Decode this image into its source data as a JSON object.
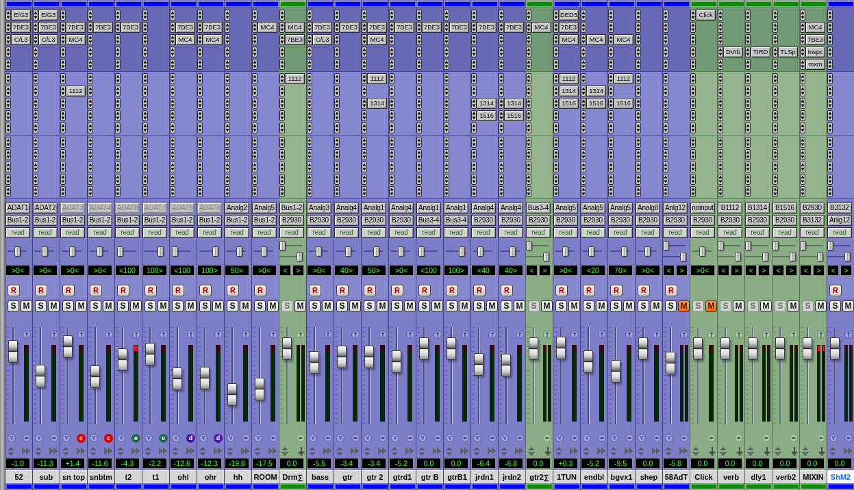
{
  "strips": [
    {
      "color": "#0000ff",
      "kind": "audio",
      "inserts": [
        {
          "assigned": true,
          "label": "E/G3"
        },
        {
          "assigned": true,
          "label": "7BE3"
        },
        {
          "assigned": true,
          "label": "C/L3"
        },
        {
          "assigned": false
        },
        {
          "assigned": false
        }
      ],
      "sends": [
        {
          "assigned": false
        },
        {
          "assigned": false
        },
        {
          "assigned": false
        },
        {
          "assigned": false
        },
        {
          "assigned": false
        }
      ],
      "input": "ADAT1",
      "input_inactive": false,
      "output": "Bus1-2",
      "automation": "read",
      "pans": [
        {
          "level": 0.5,
          "reading": ">0<"
        }
      ],
      "record": "R",
      "solo": "S",
      "solo_disabled": false,
      "mute": "M",
      "muted": false,
      "fader": {
        "level": 0.83,
        "reading": "-1.0"
      },
      "meters": [
        {
          "clipped": false
        }
      ],
      "voice": "v",
      "name": "52",
      "selected": false
    },
    {
      "color": "#0000ff",
      "kind": "audio",
      "inserts": [
        {
          "assigned": true,
          "label": "E/G3"
        },
        {
          "assigned": true,
          "label": "7BE3"
        },
        {
          "assigned": true,
          "label": "C/L3"
        },
        {
          "assigned": false
        },
        {
          "assigned": false
        }
      ],
      "sends": [
        {
          "assigned": false
        },
        {
          "assigned": false
        },
        {
          "assigned": false
        },
        {
          "assigned": false
        },
        {
          "assigned": false
        }
      ],
      "input": "ADAT2",
      "input_inactive": false,
      "output": "Bus1-2",
      "automation": "read",
      "pans": [
        {
          "level": 0.5,
          "reading": ">0<"
        }
      ],
      "record": "R",
      "solo": "S",
      "solo_disabled": false,
      "mute": "M",
      "muted": false,
      "fader": {
        "level": 0.5,
        "reading": "-11.3"
      },
      "meters": [
        {
          "clipped": false
        }
      ],
      "voice": "v",
      "name": "sub",
      "selected": false
    },
    {
      "color": "#0000ff",
      "kind": "audio",
      "inserts": [
        {
          "assigned": false
        },
        {
          "assigned": true,
          "label": "7BE3"
        },
        {
          "assigned": true,
          "label": "MC4"
        },
        {
          "assigned": false
        },
        {
          "assigned": false
        }
      ],
      "sends": [
        {
          "assigned": false
        },
        {
          "assigned": true,
          "label": "1112"
        },
        {
          "assigned": false
        },
        {
          "assigned": false
        },
        {
          "assigned": false
        }
      ],
      "input": "ADAT3",
      "input_inactive": true,
      "output": "Bus1-2",
      "automation": "read",
      "pans": [
        {
          "level": 0.5,
          "reading": ">0<"
        }
      ],
      "record": "R",
      "solo": "S",
      "solo_disabled": false,
      "mute": "M",
      "muted": false,
      "fader": {
        "level": 0.89,
        "reading": "+1.4"
      },
      "meters": [
        {
          "clipped": false
        }
      ],
      "voice": "v",
      "group": {
        "label": "c",
        "color": "#d60000"
      },
      "name": "sn top",
      "selected": false
    },
    {
      "color": "#0000ff",
      "kind": "audio",
      "inserts": [
        {
          "assigned": false
        },
        {
          "assigned": true,
          "label": "7BE3"
        },
        {
          "assigned": false
        },
        {
          "assigned": false
        },
        {
          "assigned": false
        }
      ],
      "sends": [
        {
          "assigned": false
        },
        {
          "assigned": false
        },
        {
          "assigned": false
        },
        {
          "assigned": false
        },
        {
          "assigned": false
        }
      ],
      "input": "ADAT4",
      "input_inactive": true,
      "output": "Bus1-2",
      "automation": "read",
      "pans": [
        {
          "level": 0.5,
          "reading": ">0<"
        }
      ],
      "record": "R",
      "solo": "S",
      "solo_disabled": false,
      "mute": "M",
      "muted": false,
      "fader": {
        "level": 0.49,
        "reading": "-11.6"
      },
      "meters": [
        {
          "clipped": false
        }
      ],
      "voice": "v",
      "group": {
        "label": "c",
        "color": "#d60000"
      },
      "name": "snbtm",
      "selected": false
    },
    {
      "color": "#0000ff",
      "kind": "audio",
      "inserts": [
        {
          "assigned": false
        },
        {
          "assigned": true,
          "label": "7BE3"
        },
        {
          "assigned": false
        },
        {
          "assigned": false
        },
        {
          "assigned": false
        }
      ],
      "sends": [
        {
          "assigned": false
        },
        {
          "assigned": false
        },
        {
          "assigned": false
        },
        {
          "assigned": false
        },
        {
          "assigned": false
        }
      ],
      "input": "ADAT8",
      "input_inactive": true,
      "output": "Bus1-2",
      "automation": "read",
      "pans": [
        {
          "level": 0,
          "reading": "<100"
        }
      ],
      "record": "R",
      "solo": "S",
      "solo_disabled": false,
      "mute": "M",
      "muted": false,
      "fader": {
        "level": 0.72,
        "reading": "-4.3"
      },
      "meters": [
        {
          "clipped": true
        }
      ],
      "voice": "v",
      "group": {
        "label": "e",
        "color": "#1e6a50"
      },
      "name": "t2",
      "selected": false
    },
    {
      "color": "#0000ff",
      "kind": "audio",
      "inserts": [
        {
          "assigned": false
        },
        {
          "assigned": false
        },
        {
          "assigned": false
        },
        {
          "assigned": false
        },
        {
          "assigned": false
        }
      ],
      "sends": [
        {
          "assigned": false
        },
        {
          "assigned": false
        },
        {
          "assigned": false
        },
        {
          "assigned": false
        },
        {
          "assigned": false
        }
      ],
      "input": "ADAT7",
      "input_inactive": true,
      "output": "Bus1-2",
      "automation": "read",
      "pans": [
        {
          "level": 1,
          "reading": "100>"
        }
      ],
      "record": "R",
      "solo": "S",
      "solo_disabled": false,
      "mute": "M",
      "muted": false,
      "fader": {
        "level": 0.79,
        "reading": "-2.2"
      },
      "meters": [
        {
          "clipped": false
        }
      ],
      "voice": "v",
      "group": {
        "label": "e",
        "color": "#1e6a50"
      },
      "name": "t1",
      "selected": false
    },
    {
      "color": "#0000ff",
      "kind": "audio",
      "inserts": [
        {
          "assigned": false
        },
        {
          "assigned": true,
          "label": "7BE3"
        },
        {
          "assigned": true,
          "label": "MC4"
        },
        {
          "assigned": false
        },
        {
          "assigned": false
        }
      ],
      "sends": [
        {
          "assigned": false
        },
        {
          "assigned": false
        },
        {
          "assigned": false
        },
        {
          "assigned": false
        },
        {
          "assigned": false
        }
      ],
      "input": "ADAT5",
      "input_inactive": true,
      "output": "Bus1-2",
      "automation": "read",
      "pans": [
        {
          "level": 0,
          "reading": "<100"
        }
      ],
      "record": "R",
      "solo": "S",
      "solo_disabled": false,
      "mute": "M",
      "muted": false,
      "fader": {
        "level": 0.46,
        "reading": "-12.6"
      },
      "meters": [
        {
          "clipped": false
        }
      ],
      "voice": "v",
      "group": {
        "label": "d",
        "color": "#4b14b4"
      },
      "name": "ohl",
      "selected": false
    },
    {
      "color": "#0000ff",
      "kind": "audio",
      "inserts": [
        {
          "assigned": false
        },
        {
          "assigned": true,
          "label": "7BE3"
        },
        {
          "assigned": true,
          "label": "MC4"
        },
        {
          "assigned": false
        },
        {
          "assigned": false
        }
      ],
      "sends": [
        {
          "assigned": false
        },
        {
          "assigned": false
        },
        {
          "assigned": false
        },
        {
          "assigned": false
        },
        {
          "assigned": false
        }
      ],
      "input": "ADAT6",
      "input_inactive": true,
      "output": "Bus1-2",
      "automation": "read",
      "pans": [
        {
          "level": 1,
          "reading": "100>"
        }
      ],
      "record": "R",
      "solo": "S",
      "solo_disabled": false,
      "mute": "M",
      "muted": false,
      "fader": {
        "level": 0.47,
        "reading": "-12.3"
      },
      "meters": [
        {
          "clipped": false
        }
      ],
      "voice": "v",
      "group": {
        "label": "d",
        "color": "#4b14b4"
      },
      "name": "ohr",
      "selected": false
    },
    {
      "color": "#0000ff",
      "kind": "audio",
      "inserts": [
        {
          "assigned": false
        },
        {
          "assigned": false
        },
        {
          "assigned": false
        },
        {
          "assigned": false
        },
        {
          "assigned": false
        }
      ],
      "sends": [
        {
          "assigned": false
        },
        {
          "assigned": false
        },
        {
          "assigned": false
        },
        {
          "assigned": false
        },
        {
          "assigned": false
        }
      ],
      "input": "Analg2",
      "input_inactive": false,
      "output": "Bus1-2",
      "automation": "read",
      "pans": [
        {
          "level": 0.75,
          "reading": "50>"
        }
      ],
      "record": "R",
      "solo": "S",
      "solo_disabled": false,
      "mute": "M",
      "muted": false,
      "fader": {
        "level": 0.25,
        "reading": "-19.8"
      },
      "meters": [
        {
          "clipped": false
        }
      ],
      "voice": "v",
      "name": "hh",
      "selected": false
    },
    {
      "color": "#0000ff",
      "kind": "audio",
      "inserts": [
        {
          "assigned": false
        },
        {
          "assigned": true,
          "label": "MC4"
        },
        {
          "assigned": false
        },
        {
          "assigned": false
        },
        {
          "assigned": false
        }
      ],
      "sends": [
        {
          "assigned": false
        },
        {
          "assigned": false
        },
        {
          "assigned": false
        },
        {
          "assigned": false
        },
        {
          "assigned": false
        }
      ],
      "input": "Analg5",
      "input_inactive": false,
      "output": "Bus1-2",
      "automation": "read",
      "pans": [
        {
          "level": 0.5,
          "reading": ">0<"
        }
      ],
      "record": "R",
      "solo": "S",
      "solo_disabled": false,
      "mute": "M",
      "muted": false,
      "fader": {
        "level": 0.32,
        "reading": "-17.5"
      },
      "meters": [
        {
          "clipped": false
        }
      ],
      "voice": "v",
      "name": "ROOM",
      "selected": false
    },
    {
      "color": "#0a8f0a",
      "kind": "aux",
      "inserts": [
        {
          "assigned": false
        },
        {
          "assigned": true,
          "label": "MC4"
        },
        {
          "assigned": true,
          "label": "7BE3"
        },
        {
          "assigned": false
        },
        {
          "assigned": false
        }
      ],
      "sends": [
        {
          "assigned": true,
          "label": "1112"
        },
        {
          "assigned": false
        },
        {
          "assigned": false
        },
        {
          "assigned": false
        },
        {
          "assigned": false
        }
      ],
      "input": "Bus1-2",
      "input_inactive": false,
      "output": "B2930",
      "automation": "read",
      "pans": [
        {
          "level": 0,
          "reading": "<"
        },
        {
          "level": 1,
          "reading": ">"
        }
      ],
      "solo": "S",
      "solo_disabled": true,
      "mute": "M",
      "muted": false,
      "fader": {
        "level": 0.86,
        "reading": "0.0"
      },
      "meters": [
        {
          "clipped": false
        },
        {
          "clipped": false
        }
      ],
      "name": "Drm∑",
      "selected": false
    },
    {
      "color": "#0000ff",
      "kind": "audio",
      "inserts": [
        {
          "assigned": false
        },
        {
          "assigned": true,
          "label": "7BE3"
        },
        {
          "assigned": true,
          "label": "C/L3"
        },
        {
          "assigned": false
        },
        {
          "assigned": false
        }
      ],
      "sends": [
        {
          "assigned": false
        },
        {
          "assigned": false
        },
        {
          "assigned": false
        },
        {
          "assigned": false
        },
        {
          "assigned": false
        }
      ],
      "input": "Analg3",
      "input_inactive": false,
      "output": "B2930",
      "automation": "read",
      "pans": [
        {
          "level": 0.5,
          "reading": ">0<"
        }
      ],
      "record": "R",
      "solo": "S",
      "solo_disabled": false,
      "mute": "M",
      "muted": false,
      "fader": {
        "level": 0.68,
        "reading": "-5.5"
      },
      "meters": [
        {
          "clipped": false
        }
      ],
      "voice": "v",
      "name": "bass",
      "selected": false
    },
    {
      "color": "#0000ff",
      "kind": "audio",
      "inserts": [
        {
          "assigned": false
        },
        {
          "assigned": true,
          "label": "7BE3"
        },
        {
          "assigned": false
        },
        {
          "assigned": false
        },
        {
          "assigned": false
        }
      ],
      "sends": [
        {
          "assigned": false
        },
        {
          "assigned": false
        },
        {
          "assigned": false
        },
        {
          "assigned": false
        },
        {
          "assigned": false
        }
      ],
      "input": "Analg4",
      "input_inactive": false,
      "output": "B2930",
      "automation": "read",
      "pans": [
        {
          "level": 0.7,
          "reading": "40>"
        }
      ],
      "record": "R",
      "solo": "S",
      "solo_disabled": false,
      "mute": "M",
      "muted": false,
      "fader": {
        "level": 0.75,
        "reading": "-3.4"
      },
      "meters": [
        {
          "clipped": false
        }
      ],
      "voice": "v",
      "name": "gtr",
      "selected": false
    },
    {
      "color": "#0000ff",
      "kind": "audio",
      "inserts": [
        {
          "assigned": false
        },
        {
          "assigned": true,
          "label": "7BE3"
        },
        {
          "assigned": true,
          "label": "MC4"
        },
        {
          "assigned": false
        },
        {
          "assigned": false
        }
      ],
      "sends": [
        {
          "assigned": true,
          "label": "1112"
        },
        {
          "assigned": false
        },
        {
          "assigned": true,
          "label": "1314"
        },
        {
          "assigned": false
        },
        {
          "assigned": false
        }
      ],
      "input": "Analg1",
      "input_inactive": false,
      "output": "B2930",
      "automation": "read",
      "pans": [
        {
          "level": 0.75,
          "reading": "50>"
        }
      ],
      "record": "R",
      "solo": "S",
      "solo_disabled": false,
      "mute": "M",
      "muted": false,
      "fader": {
        "level": 0.75,
        "reading": "-3.4"
      },
      "meters": [
        {
          "clipped": false
        }
      ],
      "voice": "v",
      "name": "gtr 2",
      "selected": false
    },
    {
      "color": "#0000ff",
      "kind": "audio",
      "inserts": [
        {
          "assigned": false
        },
        {
          "assigned": true,
          "label": "7BE3"
        },
        {
          "assigned": false
        },
        {
          "assigned": false
        },
        {
          "assigned": false
        }
      ],
      "sends": [
        {
          "assigned": false
        },
        {
          "assigned": false
        },
        {
          "assigned": false
        },
        {
          "assigned": false
        },
        {
          "assigned": false
        }
      ],
      "input": "Analg4",
      "input_inactive": false,
      "output": "B2930",
      "automation": "read",
      "pans": [
        {
          "level": 0.5,
          "reading": ">0<"
        }
      ],
      "record": "R",
      "solo": "S",
      "solo_disabled": false,
      "mute": "M",
      "muted": false,
      "fader": {
        "level": 0.69,
        "reading": "-5.2"
      },
      "meters": [
        {
          "clipped": false
        }
      ],
      "voice": "v",
      "name": "gtrd1",
      "selected": false
    },
    {
      "color": "#0000ff",
      "kind": "audio",
      "inserts": [
        {
          "assigned": false
        },
        {
          "assigned": true,
          "label": "7BE3"
        },
        {
          "assigned": false
        },
        {
          "assigned": false
        },
        {
          "assigned": false
        }
      ],
      "sends": [
        {
          "assigned": false
        },
        {
          "assigned": false
        },
        {
          "assigned": false
        },
        {
          "assigned": false
        },
        {
          "assigned": false
        }
      ],
      "input": "Analg1",
      "input_inactive": false,
      "output": "Bus3-4",
      "automation": "read",
      "pans": [
        {
          "level": 0,
          "reading": "<100"
        }
      ],
      "record": "R",
      "solo": "S",
      "solo_disabled": false,
      "mute": "M",
      "muted": false,
      "fader": {
        "level": 0.86,
        "reading": "0.0"
      },
      "meters": [
        {
          "clipped": false
        }
      ],
      "voice": "v",
      "name": "gtr B",
      "selected": false
    },
    {
      "color": "#0000ff",
      "kind": "audio",
      "inserts": [
        {
          "assigned": false
        },
        {
          "assigned": true,
          "label": "7BE3"
        },
        {
          "assigned": false
        },
        {
          "assigned": false
        },
        {
          "assigned": false
        }
      ],
      "sends": [
        {
          "assigned": false
        },
        {
          "assigned": false
        },
        {
          "assigned": false
        },
        {
          "assigned": false
        },
        {
          "assigned": false
        }
      ],
      "input": "Analg1",
      "input_inactive": false,
      "output": "Bus3-4",
      "automation": "read",
      "pans": [
        {
          "level": 1,
          "reading": "100>"
        }
      ],
      "record": "R",
      "solo": "S",
      "solo_disabled": false,
      "mute": "M",
      "muted": false,
      "fader": {
        "level": 0.86,
        "reading": "0.0"
      },
      "meters": [
        {
          "clipped": false
        }
      ],
      "voice": "v",
      "name": "gtrB1",
      "selected": false
    },
    {
      "color": "#0000ff",
      "kind": "audio",
      "inserts": [
        {
          "assigned": false
        },
        {
          "assigned": true,
          "label": "7BE3"
        },
        {
          "assigned": false
        },
        {
          "assigned": false
        },
        {
          "assigned": false
        }
      ],
      "sends": [
        {
          "assigned": false
        },
        {
          "assigned": false
        },
        {
          "assigned": true,
          "label": "1314"
        },
        {
          "assigned": true,
          "label": "1516"
        },
        {
          "assigned": false
        }
      ],
      "input": "Analg4",
      "input_inactive": false,
      "output": "B2930",
      "automation": "read",
      "pans": [
        {
          "level": 0.3,
          "reading": "<40"
        }
      ],
      "record": "R",
      "solo": "S",
      "solo_disabled": false,
      "mute": "M",
      "muted": false,
      "fader": {
        "level": 0.65,
        "reading": "-6.4"
      },
      "meters": [
        {
          "clipped": false
        }
      ],
      "voice": "v",
      "name": "jrdn1",
      "selected": false
    },
    {
      "color": "#0000ff",
      "kind": "audio",
      "inserts": [
        {
          "assigned": false
        },
        {
          "assigned": true,
          "label": "7BE3"
        },
        {
          "assigned": false
        },
        {
          "assigned": false
        },
        {
          "assigned": false
        }
      ],
      "sends": [
        {
          "assigned": false
        },
        {
          "assigned": false
        },
        {
          "assigned": true,
          "label": "1314"
        },
        {
          "assigned": true,
          "label": "1516"
        },
        {
          "assigned": false
        }
      ],
      "input": "Analg4",
      "input_inactive": false,
      "output": "B2930",
      "automation": "read",
      "pans": [
        {
          "level": 0.7,
          "reading": "40>"
        }
      ],
      "record": "R",
      "solo": "S",
      "solo_disabled": false,
      "mute": "M",
      "muted": false,
      "fader": {
        "level": 0.64,
        "reading": "-6.8"
      },
      "meters": [
        {
          "clipped": false
        }
      ],
      "voice": "v",
      "name": "jrdn2",
      "selected": false
    },
    {
      "color": "#0a8f0a",
      "kind": "aux",
      "inserts": [
        {
          "assigned": false
        },
        {
          "assigned": true,
          "label": "MC4"
        },
        {
          "assigned": false
        },
        {
          "assigned": false
        },
        {
          "assigned": false
        }
      ],
      "sends": [
        {
          "assigned": false
        },
        {
          "assigned": false
        },
        {
          "assigned": false
        },
        {
          "assigned": false
        },
        {
          "assigned": false
        }
      ],
      "input": "Bus3-4",
      "input_inactive": false,
      "output": "B2930",
      "automation": "read",
      "pans": [
        {
          "level": 0,
          "reading": "<"
        },
        {
          "level": 1,
          "reading": ">"
        }
      ],
      "solo": "S",
      "solo_disabled": true,
      "mute": "M",
      "muted": false,
      "fader": {
        "level": 0.86,
        "reading": "0.0"
      },
      "meters": [
        {
          "clipped": false
        },
        {
          "clipped": false
        }
      ],
      "name": "gtr2∑",
      "selected": false
    },
    {
      "color": "#0000ff",
      "kind": "audio",
      "inserts": [
        {
          "assigned": true,
          "label": "DED3"
        },
        {
          "assigned": true,
          "label": "7BE3"
        },
        {
          "assigned": true,
          "label": "MC4"
        },
        {
          "assigned": false
        },
        {
          "assigned": false
        }
      ],
      "sends": [
        {
          "assigned": true,
          "label": "1112"
        },
        {
          "assigned": true,
          "label": "1314"
        },
        {
          "assigned": true,
          "label": "1516"
        },
        {
          "assigned": false
        },
        {
          "assigned": false
        }
      ],
      "input": "Analg5",
      "input_inactive": false,
      "output": "B2930",
      "automation": "read",
      "pans": [
        {
          "level": 0.5,
          "reading": ">0<"
        }
      ],
      "record": "R",
      "solo": "S",
      "solo_disabled": false,
      "mute": "M",
      "muted": false,
      "fader": {
        "level": 0.87,
        "reading": "+0.3"
      },
      "meters": [
        {
          "clipped": false
        }
      ],
      "voice": "v",
      "name": "1TUN",
      "selected": false
    },
    {
      "color": "#0000ff",
      "kind": "audio",
      "inserts": [
        {
          "assigned": false
        },
        {
          "assigned": false
        },
        {
          "assigned": true,
          "label": "MC4"
        },
        {
          "assigned": false
        },
        {
          "assigned": false
        }
      ],
      "sends": [
        {
          "assigned": false
        },
        {
          "assigned": true,
          "label": "1314"
        },
        {
          "assigned": true,
          "label": "1516"
        },
        {
          "assigned": false
        },
        {
          "assigned": false
        }
      ],
      "input": "Analg5",
      "input_inactive": false,
      "output": "B2930",
      "automation": "read",
      "pans": [
        {
          "level": 0.4,
          "reading": "<20"
        }
      ],
      "record": "R",
      "solo": "S",
      "solo_disabled": false,
      "mute": "M",
      "muted": false,
      "fader": {
        "level": 0.69,
        "reading": "-5.2"
      },
      "meters": [
        {
          "clipped": false
        }
      ],
      "voice": "v",
      "name": "endbl",
      "selected": false
    },
    {
      "color": "#0000ff",
      "kind": "audio",
      "inserts": [
        {
          "assigned": false
        },
        {
          "assigned": false
        },
        {
          "assigned": true,
          "label": "MC4"
        },
        {
          "assigned": false
        },
        {
          "assigned": false
        }
      ],
      "sends": [
        {
          "assigned": true,
          "label": "1112"
        },
        {
          "assigned": false
        },
        {
          "assigned": true,
          "label": "1516"
        },
        {
          "assigned": false
        },
        {
          "assigned": false
        }
      ],
      "input": "Analg5",
      "input_inactive": false,
      "output": "B2930",
      "automation": "read",
      "pans": [
        {
          "level": 0.85,
          "reading": "70>"
        }
      ],
      "record": "R",
      "solo": "S",
      "solo_disabled": false,
      "mute": "M",
      "muted": false,
      "fader": {
        "level": 0.56,
        "reading": "-9.5"
      },
      "meters": [
        {
          "clipped": false
        }
      ],
      "voice": "v",
      "name": "bgvx1",
      "selected": false
    },
    {
      "color": "#0000ff",
      "kind": "audio",
      "inserts": [
        {
          "assigned": false
        },
        {
          "assigned": false
        },
        {
          "assigned": false
        },
        {
          "assigned": false
        },
        {
          "assigned": false
        }
      ],
      "sends": [
        {
          "assigned": false
        },
        {
          "assigned": false
        },
        {
          "assigned": false
        },
        {
          "assigned": false
        },
        {
          "assigned": false
        }
      ],
      "input": "Analg8",
      "input_inactive": false,
      "output": "B2930",
      "automation": "read",
      "pans": [
        {
          "level": 0.5,
          "reading": ">0<"
        }
      ],
      "record": "R",
      "solo": "S",
      "solo_disabled": false,
      "mute": "M",
      "muted": false,
      "fader": {
        "level": 0.86,
        "reading": "0.0"
      },
      "meters": [
        {
          "clipped": false
        }
      ],
      "voice": "v",
      "name": "shep",
      "selected": false
    },
    {
      "color": "#0000ff",
      "kind": "audio",
      "inserts": [
        {
          "assigned": false
        },
        {
          "assigned": false
        },
        {
          "assigned": false
        },
        {
          "assigned": false
        },
        {
          "assigned": false
        }
      ],
      "sends": [
        {
          "assigned": false
        },
        {
          "assigned": false
        },
        {
          "assigned": false
        },
        {
          "assigned": false
        },
        {
          "assigned": false
        }
      ],
      "input": "Anlg12",
      "input_inactive": false,
      "output": "B2930",
      "automation": "read",
      "pans": [
        {
          "level": 0,
          "reading": "<"
        },
        {
          "level": 1,
          "reading": ">"
        }
      ],
      "record": "R",
      "solo": "S",
      "solo_disabled": false,
      "mute": "M",
      "muted": true,
      "fader": {
        "level": 0.67,
        "reading": "-5.8"
      },
      "meters": [
        {
          "clipped": false
        },
        {
          "clipped": false
        }
      ],
      "voice": "v",
      "name": "58AdT",
      "selected": false
    },
    {
      "color": "#0a8f0a",
      "kind": "aux",
      "inserts": [
        {
          "assigned": true,
          "label": "Click"
        },
        {
          "assigned": false
        },
        {
          "assigned": false
        },
        {
          "assigned": false
        },
        {
          "assigned": false
        }
      ],
      "sends": [
        {
          "assigned": false
        },
        {
          "assigned": false
        },
        {
          "assigned": false
        },
        {
          "assigned": false
        },
        {
          "assigned": false
        }
      ],
      "input": "noinput",
      "input_inactive": false,
      "output": "B2930",
      "automation": "read",
      "pans": [
        {
          "level": 0.5,
          "reading": ">0<"
        }
      ],
      "solo": "S",
      "solo_disabled": true,
      "mute": "M",
      "muted": true,
      "fader": {
        "level": 0.86,
        "reading": "0.0"
      },
      "meters": [
        {
          "clipped": false
        }
      ],
      "name": "Click",
      "selected": false
    },
    {
      "color": "#0a8f0a",
      "kind": "aux",
      "inserts": [
        {
          "assigned": false
        },
        {
          "assigned": false
        },
        {
          "assigned": false
        },
        {
          "assigned": true,
          "label": "DVrb"
        },
        {
          "assigned": false
        }
      ],
      "sends": [
        {
          "assigned": false
        },
        {
          "assigned": false
        },
        {
          "assigned": false
        },
        {
          "assigned": false
        },
        {
          "assigned": false
        }
      ],
      "input": "B1112",
      "input_inactive": false,
      "output": "B2930",
      "automation": "read",
      "pans": [
        {
          "level": 0,
          "reading": "<"
        },
        {
          "level": 1,
          "reading": ">"
        }
      ],
      "solo": "S",
      "solo_disabled": true,
      "mute": "M",
      "muted": false,
      "fader": {
        "level": 0.86,
        "reading": "0.0"
      },
      "meters": [
        {
          "clipped": false
        },
        {
          "clipped": false
        }
      ],
      "name": "verb",
      "selected": false
    },
    {
      "color": "#0a8f0a",
      "kind": "aux",
      "inserts": [
        {
          "assigned": false
        },
        {
          "assigned": false
        },
        {
          "assigned": false
        },
        {
          "assigned": true,
          "label": "TIRD"
        },
        {
          "assigned": false
        }
      ],
      "sends": [
        {
          "assigned": false
        },
        {
          "assigned": false
        },
        {
          "assigned": false
        },
        {
          "assigned": false
        },
        {
          "assigned": false
        }
      ],
      "input": "B1314",
      "input_inactive": false,
      "output": "B2930",
      "automation": "read",
      "pans": [
        {
          "level": 0,
          "reading": "<"
        },
        {
          "level": 1,
          "reading": ">"
        }
      ],
      "solo": "S",
      "solo_disabled": true,
      "mute": "M",
      "muted": false,
      "fader": {
        "level": 0.86,
        "reading": "0.0"
      },
      "meters": [
        {
          "clipped": false
        },
        {
          "clipped": false
        }
      ],
      "name": "dly1",
      "selected": false
    },
    {
      "color": "#0a8f0a",
      "kind": "aux",
      "inserts": [
        {
          "assigned": false
        },
        {
          "assigned": false
        },
        {
          "assigned": false
        },
        {
          "assigned": true,
          "label": "TLSp"
        },
        {
          "assigned": false
        }
      ],
      "sends": [
        {
          "assigned": false
        },
        {
          "assigned": false
        },
        {
          "assigned": false
        },
        {
          "assigned": false
        },
        {
          "assigned": false
        }
      ],
      "input": "B1516",
      "input_inactive": false,
      "output": "B2930",
      "automation": "read",
      "pans": [
        {
          "level": 0,
          "reading": "<"
        },
        {
          "level": 1,
          "reading": ">"
        }
      ],
      "solo": "S",
      "solo_disabled": true,
      "mute": "M",
      "muted": false,
      "fader": {
        "level": 0.86,
        "reading": "0.0"
      },
      "meters": [
        {
          "clipped": false
        },
        {
          "clipped": false
        }
      ],
      "name": "verb2",
      "selected": false
    },
    {
      "color": "#0a8f0a",
      "kind": "aux",
      "inserts": [
        {
          "assigned": false
        },
        {
          "assigned": true,
          "label": "MC4"
        },
        {
          "assigned": true,
          "label": "7BE3"
        },
        {
          "assigned": true,
          "label": "Inspc"
        },
        {
          "assigned": true,
          "label": "mxm"
        }
      ],
      "sends": [
        {
          "assigned": false
        },
        {
          "assigned": false
        },
        {
          "assigned": false
        },
        {
          "assigned": false
        },
        {
          "assigned": false
        }
      ],
      "input": "B2930",
      "input_inactive": false,
      "output": "B3132",
      "automation": "read",
      "pans": [
        {
          "level": 0,
          "reading": "<"
        },
        {
          "level": 1,
          "reading": ">"
        }
      ],
      "solo": "S",
      "solo_disabled": true,
      "mute": "M",
      "muted": false,
      "fader": {
        "level": 0.86,
        "reading": "0.0"
      },
      "meters": [
        {
          "clipped": true
        },
        {
          "clipped": true
        }
      ],
      "name": "MIXIN",
      "selected": false
    },
    {
      "color": "#0000ff",
      "kind": "audio",
      "inserts": [
        {
          "assigned": false
        },
        {
          "assigned": false
        },
        {
          "assigned": false
        },
        {
          "assigned": false
        },
        {
          "assigned": false
        }
      ],
      "sends": [
        {
          "assigned": false
        },
        {
          "assigned": false
        },
        {
          "assigned": false
        },
        {
          "assigned": false
        },
        {
          "assigned": false
        }
      ],
      "input": "B3132",
      "input_inactive": false,
      "output": "Anlg12",
      "automation": "read",
      "pans": [
        {
          "level": 0,
          "reading": "<"
        },
        {
          "level": 1,
          "reading": ">"
        }
      ],
      "record": "R",
      "solo": "S",
      "solo_disabled": false,
      "mute": "M",
      "muted": false,
      "fader": {
        "level": 0.86,
        "reading": "0.0"
      },
      "meters": [
        {
          "clipped": false
        },
        {
          "clipped": false
        }
      ],
      "voice": "v",
      "name": "ShM2",
      "selected": true
    }
  ]
}
